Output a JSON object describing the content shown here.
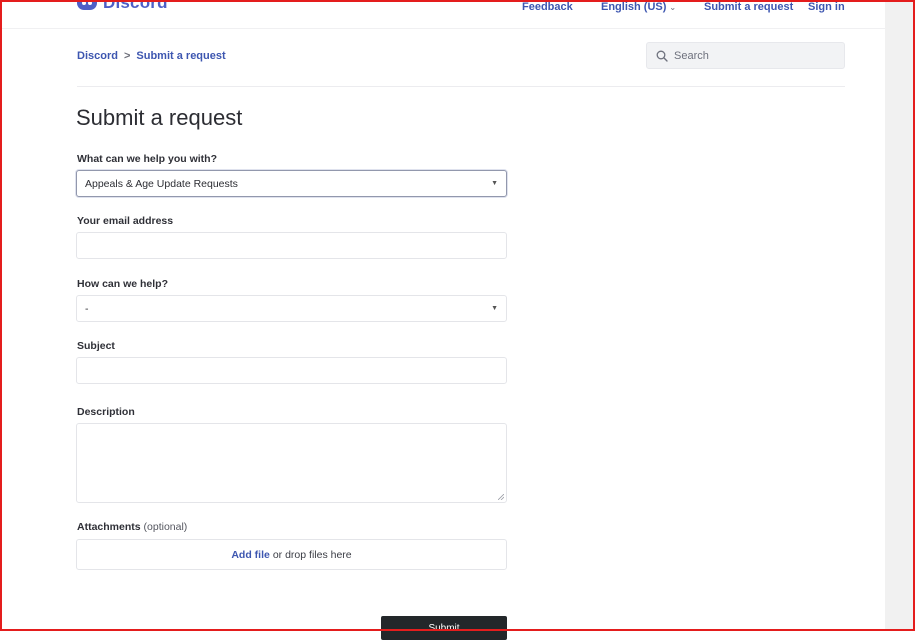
{
  "header": {
    "logo_text": "Discord",
    "nav": {
      "feedback": "Feedback",
      "language": "English (US)",
      "submit_request": "Submit a request",
      "sign_in": "Sign in"
    }
  },
  "breadcrumb": {
    "home": "Discord",
    "separator": ">",
    "current": "Submit a request"
  },
  "search": {
    "placeholder": "Search"
  },
  "page_title": "Submit a request",
  "form": {
    "help_with": {
      "label": "What can we help you with?",
      "value": "Appeals & Age Update Requests"
    },
    "email": {
      "label": "Your email address",
      "value": ""
    },
    "how_help": {
      "label": "How can we help?",
      "value": "-"
    },
    "subject": {
      "label": "Subject",
      "value": ""
    },
    "description": {
      "label": "Description",
      "value": ""
    },
    "attachments": {
      "label": "Attachments",
      "optional": "(optional)",
      "add_file": "Add file",
      "drop_text": "or drop files here"
    },
    "submit_label": "Submit"
  },
  "colors": {
    "brand": "#4e5fc7",
    "link": "#3d56b0",
    "button": "#23272a",
    "frame": "#e41d1d"
  }
}
